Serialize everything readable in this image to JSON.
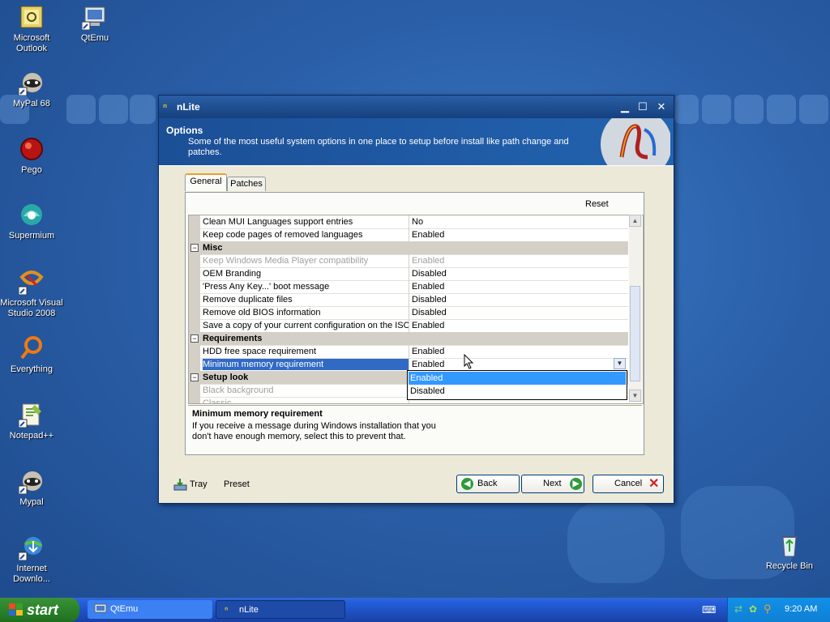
{
  "desktop": {
    "icons": [
      {
        "label": "Microsoft Outlook",
        "icon": "outlook-icon"
      },
      {
        "label": "QtEmu",
        "icon": "qtemu-icon"
      },
      {
        "label": "MyPal 68",
        "icon": "mypal-icon"
      },
      {
        "label": "Pego",
        "icon": "pego-icon"
      },
      {
        "label": "Supermium",
        "icon": "supermium-icon"
      },
      {
        "label": "Microsoft Visual Studio 2008",
        "icon": "visual-studio-icon"
      },
      {
        "label": "Everything",
        "icon": "everything-icon"
      },
      {
        "label": "Notepad++",
        "icon": "notepadpp-icon"
      },
      {
        "label": "Mypal",
        "icon": "mypal-icon"
      },
      {
        "label": "Internet Downlo...",
        "icon": "internet-download-icon"
      },
      {
        "label": "Recycle Bin",
        "icon": "recycle-bin-icon"
      }
    ]
  },
  "window": {
    "title": "nLite",
    "header_title": "Options",
    "header_desc": "Some of the most useful system options in one place to setup before install like path change and patches.",
    "tabs": [
      {
        "label": "General",
        "active": true
      },
      {
        "label": "Patches",
        "active": false
      }
    ],
    "reset_label": "Reset",
    "rows": [
      {
        "type": "item",
        "name": "Clean MUI Languages support entries",
        "value": "No"
      },
      {
        "type": "item",
        "name": "Keep code pages of removed languages",
        "value": "Enabled"
      },
      {
        "type": "cat",
        "name": "Misc",
        "toggle": "⊟"
      },
      {
        "type": "disabled",
        "name": "Keep Windows Media Player compatibility",
        "value": "Enabled"
      },
      {
        "type": "item",
        "name": "OEM Branding",
        "value": "Disabled"
      },
      {
        "type": "item",
        "name": "'Press Any Key...' boot message",
        "value": "Enabled"
      },
      {
        "type": "item",
        "name": "Remove duplicate files",
        "value": "Disabled"
      },
      {
        "type": "item",
        "name": "Remove old BIOS information",
        "value": "Disabled"
      },
      {
        "type": "item",
        "name": "Save a copy of your current configuration on the ISO",
        "value": "Enabled"
      },
      {
        "type": "cat",
        "name": "Requirements",
        "toggle": "⊟"
      },
      {
        "type": "item",
        "name": "HDD free space requirement",
        "value": "Enabled"
      },
      {
        "type": "sel",
        "name": "Minimum memory requirement",
        "value": "Enabled"
      },
      {
        "type": "cat",
        "name": "Setup look",
        "toggle": "⊟"
      },
      {
        "type": "disabled",
        "name": "Black background",
        "value": ""
      },
      {
        "type": "disabled",
        "name": "Classic",
        "value": ""
      }
    ],
    "dropdown_options": [
      {
        "label": "Enabled",
        "highlighted": true
      },
      {
        "label": "Disabled",
        "highlighted": false
      }
    ],
    "description_title": "Minimum memory requirement",
    "description_text": "If you receive a message during Windows installation that you don't have enough memory, select this to prevent that.",
    "buttons": {
      "tray": "Tray",
      "preset": "Preset",
      "back": "Back",
      "next": "Next",
      "cancel": "Cancel"
    }
  },
  "taskbar": {
    "start_label": "start",
    "tasks": [
      {
        "label": "QtEmu",
        "active": false
      },
      {
        "label": "nLite",
        "active": true
      }
    ],
    "clock": "9:20 AM"
  },
  "colors": {
    "selection": "#316ac5",
    "dropdown_highlight": "#3399ff",
    "taskbar": "#245edb",
    "start": "#2f8a2f"
  }
}
